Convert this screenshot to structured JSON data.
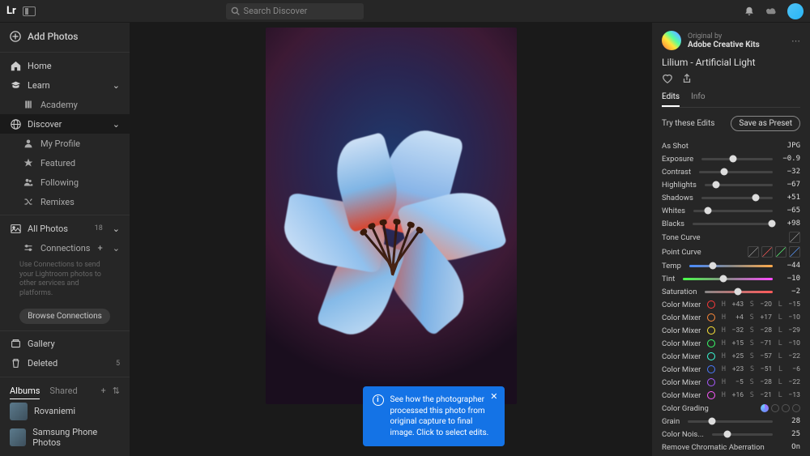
{
  "header": {
    "logo": "Lr",
    "search_placeholder": "Search Discover"
  },
  "sidebar": {
    "add": "Add Photos",
    "home": "Home",
    "learn": "Learn",
    "academy": "Academy",
    "discover": "Discover",
    "profile": "My Profile",
    "featured": "Featured",
    "following": "Following",
    "remixes": "Remixes",
    "allphotos": "All Photos",
    "allphotos_count": "18",
    "connections": "Connections",
    "conn_note": "Use Connections to send your Lightroom photos to other services and platforms.",
    "browse": "Browse Connections",
    "gallery": "Gallery",
    "deleted": "Deleted",
    "deleted_count": "5",
    "tab_albums": "Albums",
    "tab_shared": "Shared",
    "albums": [
      "Rovaniemi",
      "Samsung Phone Photos"
    ]
  },
  "tooltip": {
    "text": "See how the photographer processed this photo from original capture to final image. Click to select edits."
  },
  "panel": {
    "orig_by": "Original by",
    "author": "Adobe Creative Kits",
    "title": "Lilium - Artificial Light",
    "tab_edits": "Edits",
    "tab_info": "Info",
    "try": "Try these Edits",
    "save": "Save as Preset",
    "asshot": "As Shot",
    "jpg": "JPG",
    "sliders": [
      {
        "label": "Exposure",
        "value": "−0.9",
        "pos": 44
      },
      {
        "label": "Contrast",
        "value": "−32",
        "pos": 34
      },
      {
        "label": "Highlights",
        "value": "−67",
        "pos": 17
      },
      {
        "label": "Shadows",
        "value": "+51",
        "pos": 76
      },
      {
        "label": "Whites",
        "value": "−65",
        "pos": 18
      },
      {
        "label": "Blacks",
        "value": "+98",
        "pos": 99
      }
    ],
    "tonecurve": "Tone Curve",
    "pointcurve": "Point Curve",
    "temp": {
      "label": "Temp",
      "value": "−44",
      "pos": 28
    },
    "tint": {
      "label": "Tint",
      "value": "−10",
      "pos": 45
    },
    "sat": {
      "label": "Saturation",
      "value": "−2",
      "pos": 49
    },
    "colormix_label": "Color Mixer",
    "mixers": [
      {
        "color": "#ff3a3a",
        "h": "+43",
        "s": "−20",
        "l": "−15"
      },
      {
        "color": "#ff8a3a",
        "h": "+4",
        "s": "+17",
        "l": "−10"
      },
      {
        "color": "#ffe63a",
        "h": "−32",
        "s": "−28",
        "l": "−29"
      },
      {
        "color": "#3aff6a",
        "h": "+15",
        "s": "−71",
        "l": "−10"
      },
      {
        "color": "#3affda",
        "h": "+25",
        "s": "−57",
        "l": "−22"
      },
      {
        "color": "#4a7aff",
        "h": "+23",
        "s": "−51",
        "l": "−6"
      },
      {
        "color": "#aa5aff",
        "h": "−5",
        "s": "−28",
        "l": "−22"
      },
      {
        "color": "#ff5aff",
        "h": "+16",
        "s": "−21",
        "l": "−13"
      }
    ],
    "colorgrading": "Color Grading",
    "grain": {
      "label": "Grain",
      "value": "28",
      "pos": 28
    },
    "noise": {
      "label": "Color Nois...",
      "value": "25",
      "pos": 25
    },
    "rca": {
      "label": "Remove Chromatic Aberration",
      "value": "On"
    }
  }
}
